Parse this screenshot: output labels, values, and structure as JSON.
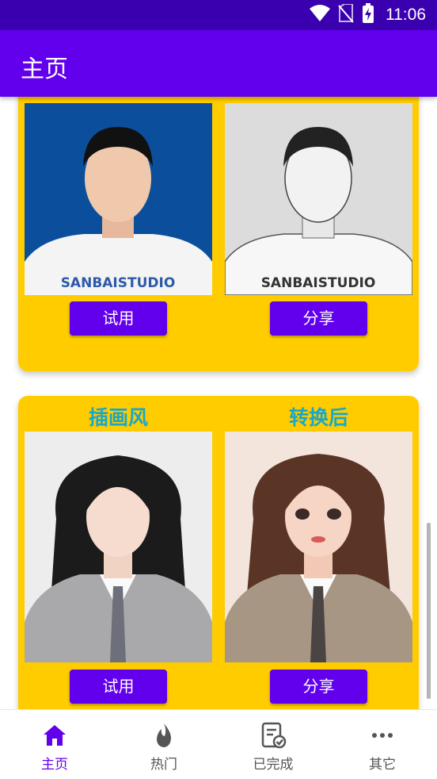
{
  "status_bar": {
    "time": "11:06",
    "icons": [
      "wifi-icon",
      "no-sim-icon",
      "battery-charging-icon"
    ]
  },
  "app_bar": {
    "title": "主页"
  },
  "cards": [
    {
      "left_label": "",
      "right_label": "",
      "left_button": "试用",
      "right_button": "分享"
    },
    {
      "left_label": "插画风",
      "right_label": "转换后",
      "left_button": "试用",
      "right_button": "分享"
    }
  ],
  "bottom_nav": {
    "items": [
      {
        "label": "主页",
        "icon": "home-icon",
        "active": true
      },
      {
        "label": "热门",
        "icon": "fire-icon",
        "active": false
      },
      {
        "label": "已完成",
        "icon": "completed-document-icon",
        "active": false
      },
      {
        "label": "其它",
        "icon": "more-dots-icon",
        "active": false
      }
    ]
  },
  "colors": {
    "status_bar": "#3a00b0",
    "primary": "#6200ee",
    "card": "#ffcc00",
    "label": "#1aa7c9"
  }
}
